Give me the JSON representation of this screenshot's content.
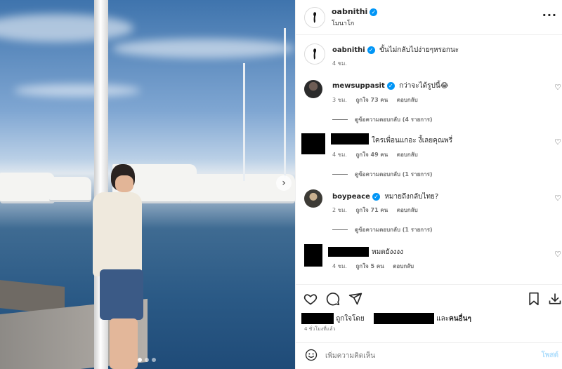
{
  "header": {
    "username": "oabnithi",
    "subtitle": "โมนาโก",
    "more_icon": "more-horizontal-icon"
  },
  "photo": {
    "carousel_slides": 3,
    "active_slide": 1,
    "next_icon": "chevron-right-icon"
  },
  "caption": {
    "username": "oabnithi",
    "text": "ขั้นไม่กลับไปง่ายๆหรอกนะ",
    "time": "4 ชม."
  },
  "comments": [
    {
      "username": "mewsuppasit",
      "verified": true,
      "text": "กว่าจะได้รูปนี้😂",
      "time": "3 ชม.",
      "likes": "ถูกใจ 73 คน",
      "reply": "ตอบกลับ",
      "view_replies": "ดูข้อความตอบกลับ (4 รายการ)"
    },
    {
      "username": "",
      "redacted": true,
      "text": "ใครเพื่อนแกอะ งี้เลยคุณพรี่",
      "time": "4 ชม.",
      "likes": "ถูกใจ 49 คน",
      "reply": "ตอบกลับ",
      "view_replies": "ดูข้อความตอบกลับ (1 รายการ)"
    },
    {
      "username": "boypeace",
      "verified": true,
      "text": "หมายถึงกลับไทย?",
      "time": "2 ชม.",
      "likes": "ถูกใจ 71 คน",
      "reply": "ตอบกลับ",
      "view_replies": "ดูข้อความตอบกลับ (1 รายการ)"
    },
    {
      "username": "",
      "redacted": true,
      "text": "หมดยังงงง",
      "time": "4 ชม.",
      "likes": "ถูกใจ 5 คน",
      "reply": "ตอบกลับ"
    }
  ],
  "actions": {
    "like_icon": "heart-icon",
    "comment_icon": "comment-icon",
    "share_icon": "send-icon",
    "save_icon": "bookmark-icon",
    "download_icon": "download-icon"
  },
  "likes_line": {
    "prefix": "ถูกใจโดย",
    "suffix_plain": "และ",
    "suffix_bold": "คนอื่นๆ"
  },
  "time_ago": "4 ชั่วโมงที่แล้ว",
  "add_comment": {
    "placeholder": "เพิ่มความคิดเห็น",
    "post_label": "โพสต์",
    "emoji_icon": "emoji-icon"
  },
  "colors": {
    "verified": "#0095f6",
    "post_disabled": "#b2dffc",
    "muted": "#737373"
  }
}
